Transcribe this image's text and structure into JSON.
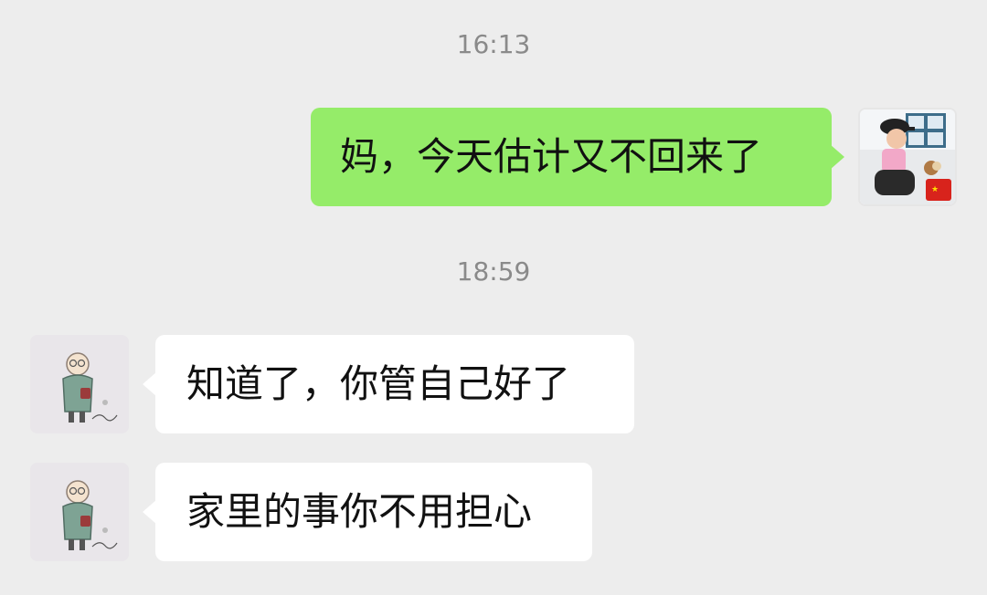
{
  "messages": [
    {
      "type": "timestamp",
      "text": "16:13"
    },
    {
      "type": "outgoing",
      "text": "妈，今天估计又不回来了",
      "avatar_icon": "child-photo-avatar"
    },
    {
      "type": "timestamp",
      "text": "18:59"
    },
    {
      "type": "incoming",
      "text": "知道了，你管自己好了",
      "avatar_icon": "grandma-cartoon-avatar"
    },
    {
      "type": "incoming",
      "text": "家里的事你不用担心",
      "avatar_icon": "grandma-cartoon-avatar"
    }
  ],
  "colors": {
    "background": "#ededed",
    "outgoing_bubble": "#95ec69",
    "incoming_bubble": "#ffffff",
    "timestamp_text": "#8a8a8a"
  }
}
